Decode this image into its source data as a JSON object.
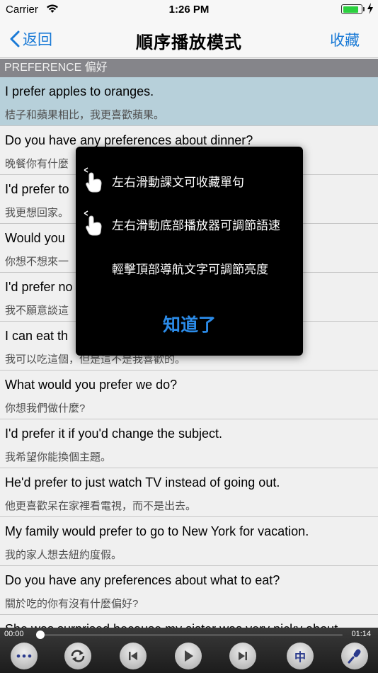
{
  "status": {
    "carrier": "Carrier",
    "time": "1:26 PM",
    "battery": 0.9
  },
  "nav": {
    "back_label": "返回",
    "title": "順序播放模式",
    "favorite_label": "收藏"
  },
  "section": {
    "title": "PREFERENCE 偏好"
  },
  "rows": [
    {
      "en": "I prefer apples to oranges.",
      "zh": "桔子和蘋果相比，我更喜歡蘋果。"
    },
    {
      "en": "Do you have any preferences about dinner?",
      "zh": "晚餐你有什麼"
    },
    {
      "en": "I'd prefer to",
      "zh": "我更想回家。"
    },
    {
      "en": "Would you",
      "zh": "你想不想來一"
    },
    {
      "en": "I'd prefer no",
      "zh": "我不願意談這"
    },
    {
      "en": "I can eat th",
      "zh": "我可以吃這個，但是這不是我喜歡的。"
    },
    {
      "en": "What would you prefer we do?",
      "zh": "你想我們做什麼?"
    },
    {
      "en": "I'd prefer it if you'd change the subject.",
      "zh": "我希望你能換個主題。"
    },
    {
      "en": "He'd prefer to just watch TV instead of going out.",
      "zh": "他更喜歡呆在家裡看電視，而不是出去。"
    },
    {
      "en": "My family would prefer to go to New York for vacation.",
      "zh": "我的家人想去紐約度假。"
    },
    {
      "en": "Do you have any preferences about what to eat?",
      "zh": "關於吃的你有沒有什麼偏好?"
    },
    {
      "en": "She was surprised because my sister was very picky about",
      "zh": ""
    }
  ],
  "popup": {
    "tips": [
      {
        "text": "左右滑動課文可收藏單句",
        "icon": "swipe-hand-icon"
      },
      {
        "text": "左右滑動底部播放器可調節語速",
        "icon": "swipe-hand-icon"
      },
      {
        "text": "輕擊頂部導航文字可調節亮度",
        "icon": ""
      }
    ],
    "ok_label": "知道了"
  },
  "player": {
    "elapsed": "00:00",
    "duration": "01:14",
    "progress": 0.0,
    "lang_label": "中",
    "buttons": [
      "more-icon",
      "repeat-icon",
      "previous-icon",
      "play-icon",
      "next-icon",
      "chinese-toggle",
      "microphone-icon"
    ]
  },
  "colors": {
    "accent": "#1a7ad6",
    "selected_row": "#c3dde8",
    "section_header": "#8e8e93",
    "ok_button": "#2b8be8"
  }
}
